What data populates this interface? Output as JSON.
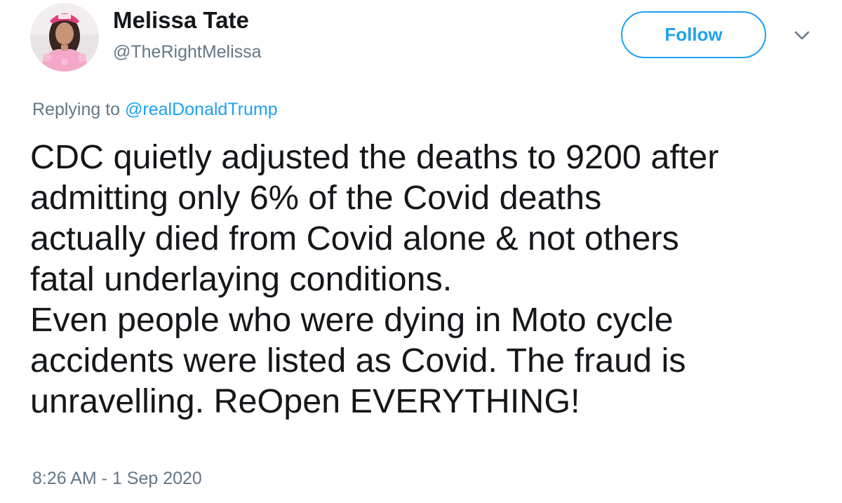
{
  "author": {
    "display_name": "Melissa Tate",
    "handle": "@TheRightMelissa"
  },
  "follow_label": "Follow",
  "icons": {
    "avatar": "profile-photo",
    "menu": "chevron-down-icon"
  },
  "reply": {
    "prefix": "Replying to",
    "mention": "@realDonaldTrump"
  },
  "tweet": {
    "lines": [
      "CDC quietly adjusted the deaths to 9200 after",
      "admitting only 6% of the Covid deaths",
      "actually died from Covid alone & not others",
      "fatal underlaying conditions.",
      "Even people who were dying in Moto cycle",
      "accidents were listed as Covid. The fraud is",
      "unravelling. ReOpen EVERYTHING!"
    ]
  },
  "timestamp": "8:26 AM - 1 Sep 2020",
  "colors": {
    "accent": "#1da1f2",
    "secondary_text": "#657786",
    "primary_text": "#14171a"
  }
}
